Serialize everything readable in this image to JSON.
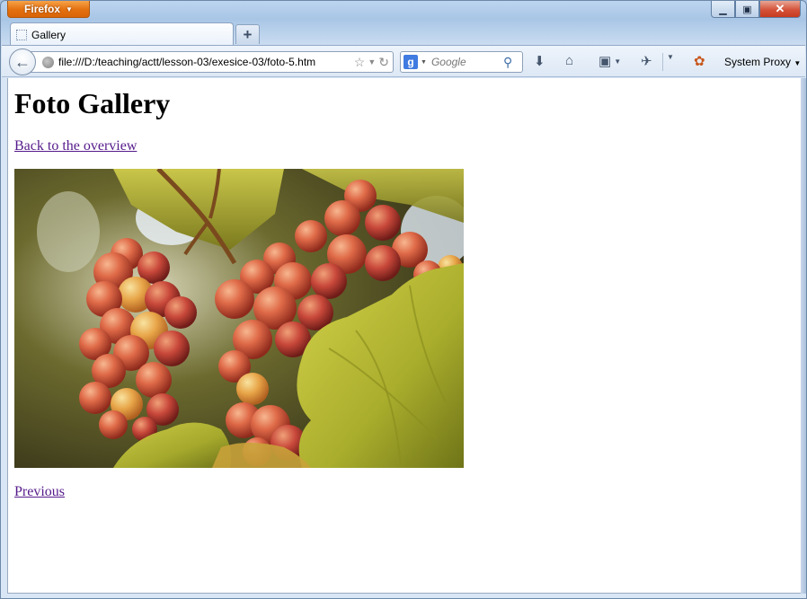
{
  "browser": {
    "app_button_label": "Firefox",
    "tab_title": "Gallery",
    "new_tab_label": "+",
    "url": "file:///D:/teaching/actt/lesson-03/exesice-03/foto-5.htm",
    "search_placeholder": "Google",
    "search_engine_letter": "g",
    "proxy_label": "System Proxy"
  },
  "page": {
    "title": "Foto Gallery",
    "back_link": "Back to the overview",
    "previous_link": "Previous"
  },
  "colors": {
    "link_visited": "#551a8b",
    "firefox_orange": "#e3700f",
    "close_red": "#c53a20"
  },
  "icons": [
    "back-arrow-icon",
    "globe-icon",
    "bookmark-star-icon",
    "reload-icon",
    "google-icon",
    "search-icon",
    "download-icon",
    "home-icon",
    "bookmarks-icon",
    "addon-icon",
    "firebug-icon"
  ]
}
